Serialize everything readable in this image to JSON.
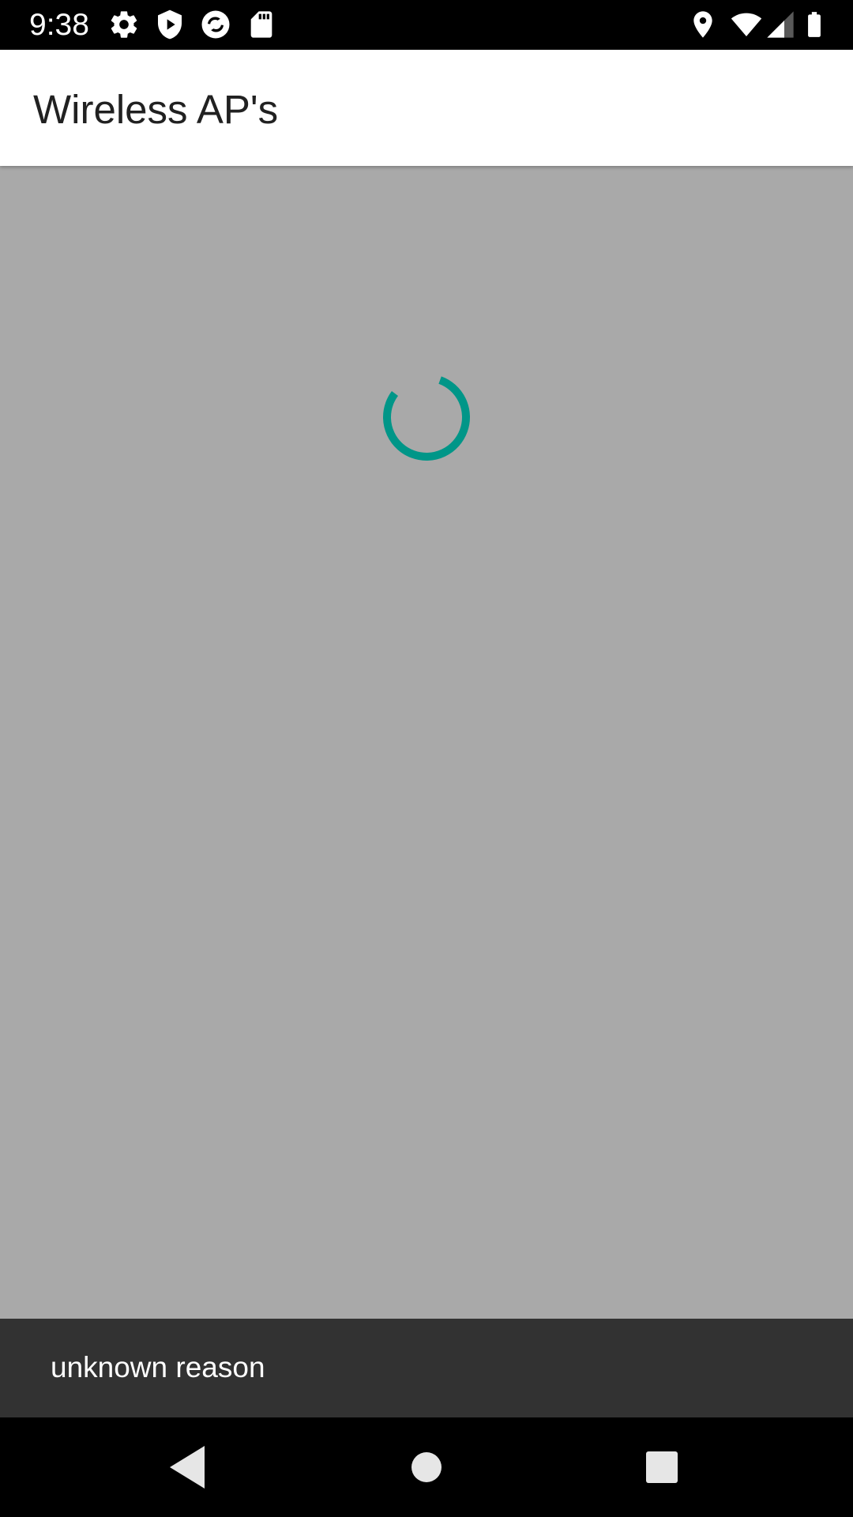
{
  "status_bar": {
    "time": "9:38",
    "left_icons": [
      "gear-icon",
      "shield-play-icon",
      "sync-icon",
      "sd-card-icon"
    ],
    "right_icons": [
      "location-icon",
      "wifi-icon",
      "cell-signal-icon",
      "battery-icon"
    ]
  },
  "app_bar": {
    "title": "Wireless AP's"
  },
  "content": {
    "background_color": "#a9a9a9",
    "loading_indicator": {
      "icon": "progress-spinner-icon",
      "color": "#009688"
    }
  },
  "snackbar": {
    "message": "unknown reason"
  },
  "nav_bar": {
    "buttons": [
      "back-icon",
      "home-icon",
      "recents-icon"
    ]
  },
  "colors": {
    "accent": "#009688",
    "status_bar": "#000000",
    "app_bar": "#ffffff",
    "snackbar": "#323232"
  }
}
